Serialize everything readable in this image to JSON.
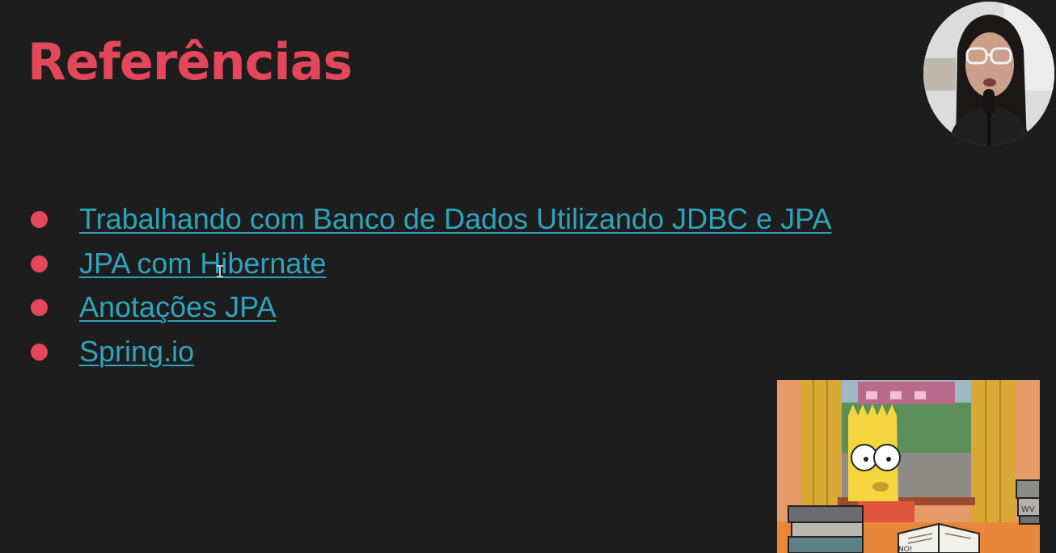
{
  "slide": {
    "title": "Referências",
    "references": [
      {
        "label": "Trabalhando com Banco de Dados Utilizando JDBC e JPA"
      },
      {
        "label": "JPA com Hibernate"
      },
      {
        "label": "Anotações JPA"
      },
      {
        "label": "Spring.io"
      }
    ]
  },
  "meme_image": {
    "sign_text": "NO!",
    "book_text": "WV"
  },
  "colors": {
    "background": "#1d1d1d",
    "title": "#e5475a",
    "bullet": "#e5475a",
    "link": "#2fa3bd"
  }
}
